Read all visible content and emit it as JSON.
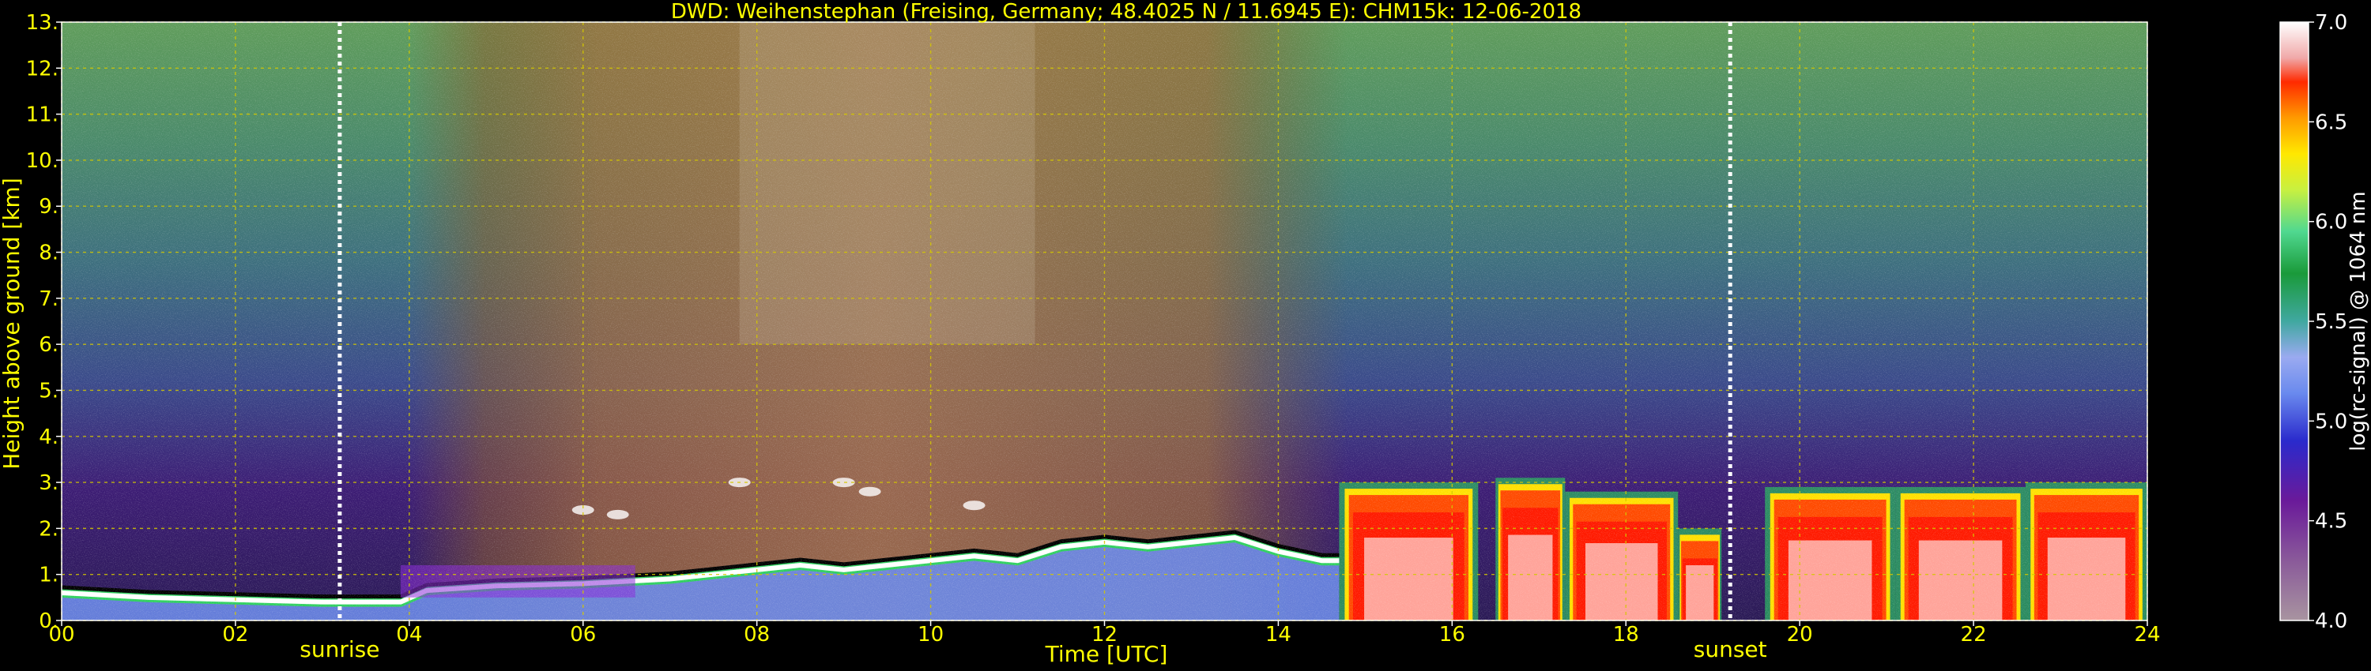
{
  "chart_data": {
    "type": "heatmap",
    "title": "DWD: Weihenstephan (Freising, Germany; 48.4025 N / 11.6945 E):    CHM15k: 12-06-2018",
    "xlabel": "Time [UTC]",
    "ylabel": "Height above ground [km]",
    "xlim": [
      0,
      24
    ],
    "ylim": [
      0,
      13
    ],
    "x_ticks": [
      "00",
      "02",
      "04",
      "06",
      "08",
      "10",
      "12",
      "14",
      "16",
      "18",
      "20",
      "22",
      "24"
    ],
    "y_ticks": [
      "0.",
      "1.",
      "2.",
      "3.",
      "4.",
      "5.",
      "6.",
      "7.",
      "8.",
      "9.",
      "10.",
      "11.",
      "12.",
      "13."
    ],
    "grid": true,
    "colorbar": {
      "label": "log(rc-signal) @ 1064 nm",
      "range": [
        4.0,
        7.0
      ],
      "ticks": [
        "4.0",
        "4.5",
        "5.0",
        "5.5",
        "6.0",
        "6.5",
        "7.0"
      ]
    },
    "annotations": [
      {
        "text": "sunrise",
        "x": 3.2
      },
      {
        "text": "sunset",
        "x": 19.2
      }
    ],
    "cloud_base_height_km": {
      "times": [
        0,
        1,
        2,
        3,
        3.9,
        4.2,
        5,
        6,
        7,
        7.5,
        8,
        8.5,
        9,
        9.5,
        10,
        10.5,
        11,
        11.5,
        12,
        12.5,
        13,
        13.5,
        14,
        14.5,
        14.7
      ],
      "heights": [
        0.6,
        0.5,
        0.45,
        0.4,
        0.4,
        0.65,
        0.75,
        0.8,
        0.9,
        1.0,
        1.1,
        1.2,
        1.1,
        1.2,
        1.3,
        1.4,
        1.3,
        1.6,
        1.7,
        1.6,
        1.7,
        1.8,
        1.5,
        1.3,
        1.3
      ]
    },
    "convective_clouds": [
      {
        "start": 14.7,
        "end": 16.3,
        "top_km": 3.0
      },
      {
        "start": 16.5,
        "end": 17.3,
        "top_km": 3.1
      },
      {
        "start": 17.3,
        "end": 18.6,
        "top_km": 2.8
      },
      {
        "start": 18.6,
        "end": 19.1,
        "top_km": 2.0
      },
      {
        "start": 19.6,
        "end": 21.1,
        "top_km": 2.9
      },
      {
        "start": 21.1,
        "end": 22.6,
        "top_km": 2.9
      },
      {
        "start": 22.6,
        "end": 24.0,
        "top_km": 3.0
      }
    ]
  },
  "colors": {
    "background": "#000000",
    "text": "#ffff00",
    "grid": "#d4c800",
    "sun_marker": "#ffffff"
  }
}
